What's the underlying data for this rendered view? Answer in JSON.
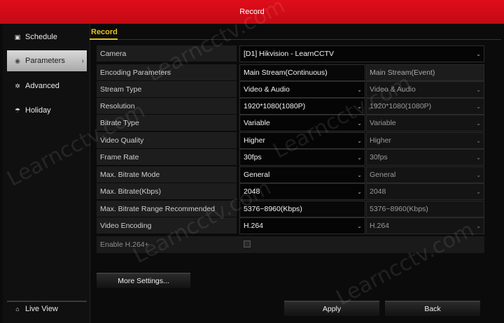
{
  "window": {
    "title": "Record"
  },
  "sidebar": {
    "items": [
      {
        "icon": "schedule-icon",
        "glyph": "▣",
        "label": "Schedule"
      },
      {
        "icon": "parameters-icon",
        "glyph": "◉",
        "label": "Parameters"
      },
      {
        "icon": "advanced-icon",
        "glyph": "✲",
        "label": "Advanced"
      },
      {
        "icon": "holiday-icon",
        "glyph": "☂",
        "label": "Holiday"
      }
    ],
    "live_view": {
      "icon": "home-icon",
      "glyph": "⌂",
      "label": "Live View"
    }
  },
  "tabs": [
    {
      "label": "Record"
    }
  ],
  "form": {
    "camera": {
      "label": "Camera",
      "value": "[D1] Hikvision - LearnCCTV"
    },
    "header": {
      "label": "Encoding Parameters",
      "main": "Main Stream(Continuous)",
      "event": "Main Stream(Event)"
    },
    "rows": [
      {
        "label": "Stream Type",
        "main": "Video & Audio",
        "event": "Video & Audio"
      },
      {
        "label": "Resolution",
        "main": "1920*1080(1080P)",
        "event": "1920*1080(1080P)"
      },
      {
        "label": "Bitrate Type",
        "main": "Variable",
        "event": "Variable"
      },
      {
        "label": "Video Quality",
        "main": "Higher",
        "event": "Higher"
      },
      {
        "label": "Frame Rate",
        "main": "30fps",
        "event": "30fps"
      },
      {
        "label": "Max. Bitrate Mode",
        "main": "General",
        "event": "General"
      },
      {
        "label": "Max. Bitrate(Kbps)",
        "main": "2048",
        "event": "2048"
      },
      {
        "label": "Max. Bitrate Range Recommended",
        "main": "5376~8960(Kbps)",
        "event": "5376~8960(Kbps)"
      },
      {
        "label": "Video Encoding",
        "main": "H.264",
        "event": "H.264"
      }
    ],
    "enable_h264plus": {
      "label": "Enable H.264+"
    }
  },
  "buttons": {
    "more_settings": "More Settings...",
    "apply": "Apply",
    "back": "Back"
  },
  "watermark": "Learncctv.com",
  "colors": {
    "title_bar": "#d40b18",
    "tab_accent": "#e8c21b",
    "active_item": "#c8c8c8"
  }
}
